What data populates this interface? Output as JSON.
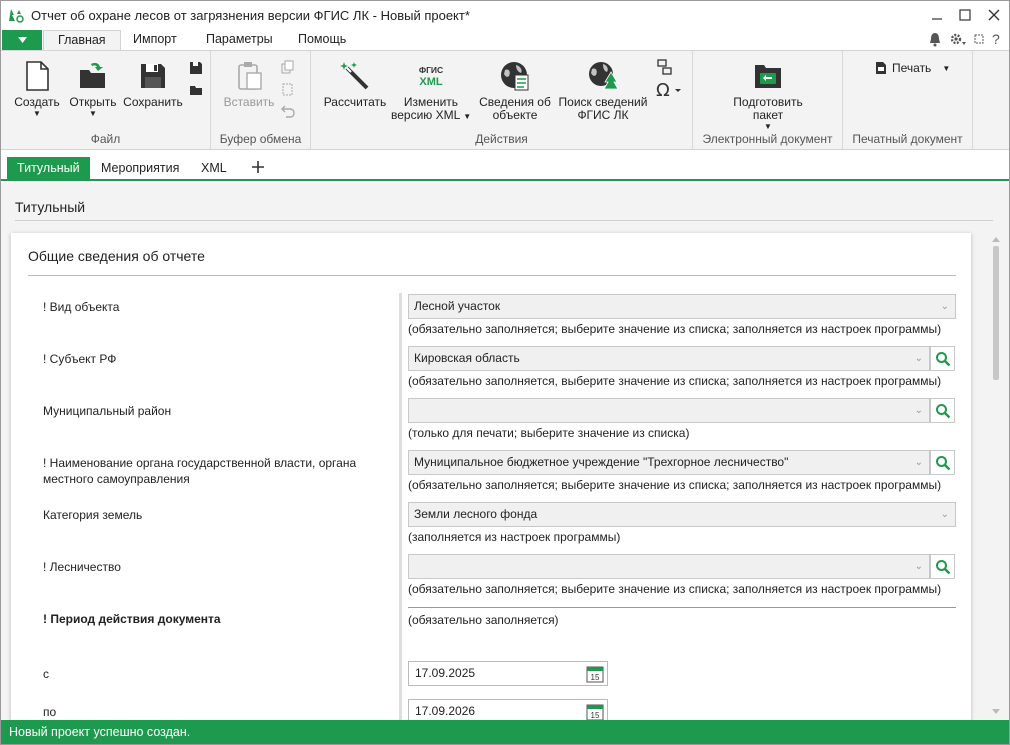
{
  "window": {
    "title": "Отчет об охране лесов от загрязнения версии ФГИС ЛК - Новый проект*"
  },
  "menu": {
    "tabs": [
      "Главная",
      "Импорт",
      "Параметры",
      "Помощь"
    ]
  },
  "ribbon": {
    "groups": {
      "file": "Файл",
      "clipboard": "Буфер обмена",
      "actions": "Действия",
      "edoc": "Электронный документ",
      "print": "Печатный документ"
    },
    "buttons": {
      "create": "Создать",
      "open": "Открыть",
      "save": "Сохранить",
      "paste": "Вставить",
      "calculate": "Рассчитать",
      "change_xml_1": "Изменить",
      "change_xml_2": "версию XML",
      "object_info_1": "Сведения об",
      "object_info_2": "объекте",
      "fgis_search_1": "Поиск сведений",
      "fgis_search_2": "ФГИС ЛК",
      "prepare_1": "Подготовить",
      "prepare_2": "пакет",
      "print": "Печать",
      "fgis_xml_top": "ФГИС",
      "fgis_xml_bottom": "XML"
    }
  },
  "doctabs": [
    "Титульный",
    "Мероприятия",
    "XML"
  ],
  "page": {
    "section_title": "Титульный",
    "card_title": "Общие сведения об отчете",
    "rows": [
      {
        "label": "! Вид объекта",
        "value": "Лесной участок",
        "hint": "(обязательно заполняется; выберите значение из списка; заполняется из настроек программы)"
      },
      {
        "label": "! Субъект РФ",
        "value": "Кировская область",
        "hint": "(обязательно заполняется, выберите значение из списка; заполняется из настроек программы)"
      },
      {
        "label": "Муниципальный район",
        "value": "",
        "hint": "(только для печати; выберите значение из списка)"
      },
      {
        "label": "! Наименование органа государственной власти, органа местного самоуправления",
        "value": "Муниципальное бюджетное учреждение \"Трехгорное лесничество\"",
        "hint": "(обязательно заполняется; выберите значение из списка; заполняется из настроек программы)"
      },
      {
        "label": "Категория земель",
        "value": "Земли лесного фонда",
        "hint": "(заполняется из настроек программы)"
      },
      {
        "label": "! Лесничество",
        "value": "",
        "hint": "(обязательно заполняется; выберите значение из списка; заполняется из настроек программы)"
      }
    ],
    "period": {
      "label": "! Период действия документа",
      "hint": "(обязательно заполняется)",
      "from_label": "с",
      "from_value": "17.09.2025",
      "to_label": "по",
      "to_value": "17.09.2026",
      "cal_day": "15"
    }
  },
  "status": {
    "text": "Новый проект успешно создан."
  },
  "colors": {
    "accent": "#1e9a4e",
    "ribbon_bg": "#f3f3f3"
  }
}
